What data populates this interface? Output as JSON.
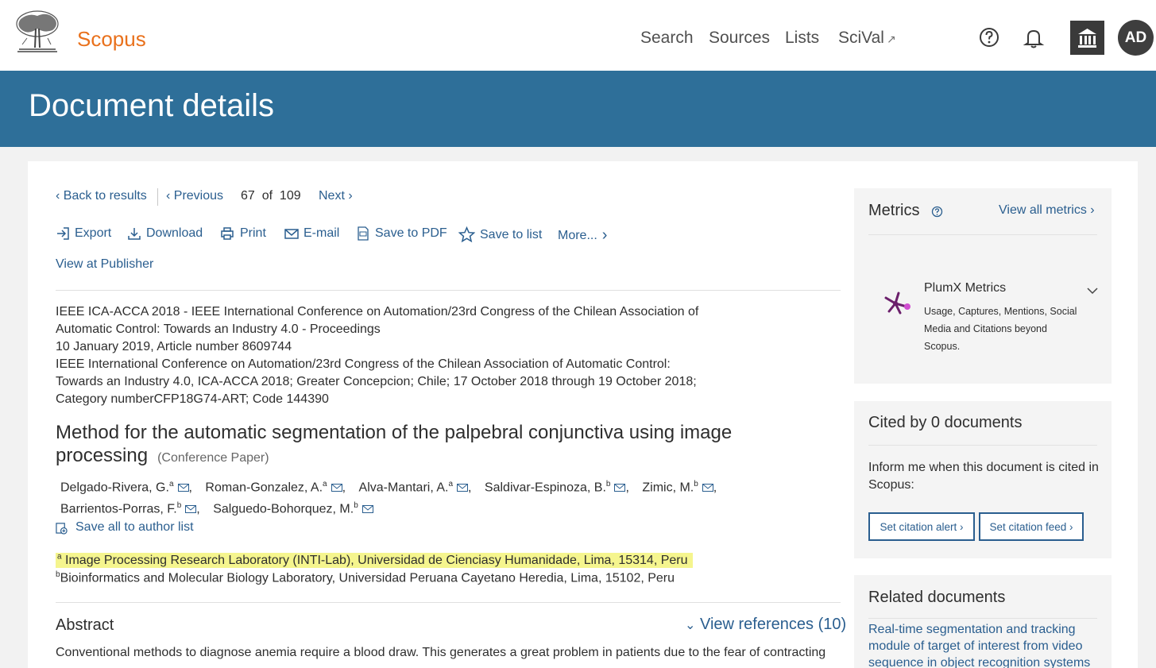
{
  "header": {
    "brand": "Scopus",
    "nav": {
      "search": "Search",
      "sources": "Sources",
      "lists": "Lists",
      "scival": "SciVal",
      "scival_ext": "↗"
    },
    "avatar_initials": "AD"
  },
  "banner": {
    "title": "Document details"
  },
  "pagination": {
    "back": "Back to results",
    "previous": "Previous",
    "current": "67",
    "of_label": "of",
    "total": "109",
    "next": "Next"
  },
  "toolbar": {
    "export": "Export",
    "download": "Download",
    "print": "Print",
    "email": "E-mail",
    "save_pdf": "Save to PDF",
    "save_list": "Save to list",
    "more": "More..."
  },
  "view_publisher": "View at Publisher",
  "source": {
    "lines": [
      "IEEE ICA-ACCA 2018 - IEEE International Conference on Automation/23rd Congress of the Chilean Association of",
      "Automatic Control: Towards an Industry 4.0 - Proceedings",
      "10 January 2019, Article number 8609744",
      "IEEE International Conference on Automation/23rd Congress of the Chilean Association of Automatic Control:",
      "Towards an Industry 4.0, ICA-ACCA 2018; Greater Concepcion; Chile; 17 October 2018 through 19 October 2018;",
      "Category numberCFP18G74-ART; Code 144390"
    ]
  },
  "document": {
    "title": "Method for the automatic segmentation of the palpebral conjunctiva using image processing",
    "type": "(Conference Paper)"
  },
  "authors": [
    {
      "name": "Delgado-Rivera, G.",
      "sup": "a"
    },
    {
      "name": "Roman-Gonzalez, A.",
      "sup": "a"
    },
    {
      "name": "Alva-Mantari, A.",
      "sup": "a"
    },
    {
      "name": "Saldivar-Espinoza, B.",
      "sup": "b"
    },
    {
      "name": "Zimic, M.",
      "sup": "b"
    },
    {
      "name": "Barrientos-Porras, F.",
      "sup": "b"
    },
    {
      "name": "Salguedo-Bohorquez, M.",
      "sup": "b"
    }
  ],
  "save_authors": "Save all to author list",
  "affiliations": [
    {
      "sup": "a",
      "text": "Image Processing Research Laboratory (INTI-Lab), Universidad de Cienciasy Humanidade, Lima, 15314, Peru"
    },
    {
      "sup": "b",
      "text": "Bioinformatics and Molecular Biology Laboratory, Universidad Peruana Cayetano Heredia, Lima, 15102, Peru"
    }
  ],
  "abstract": {
    "title": "Abstract",
    "view_refs": "View references (10)",
    "text": "Conventional methods to diagnose anemia require a blood draw. This generates a great problem in patients due to the fear of contracting"
  },
  "metrics": {
    "title": "Metrics",
    "view_all": "View all metrics",
    "plumx_title": "PlumX Metrics",
    "plumx_desc": "Usage, Captures, Mentions, Social Media and Citations beyond Scopus."
  },
  "cited": {
    "title": "Cited by 0 documents",
    "desc": "Inform me when this document is cited in Scopus:",
    "alert_btn": "Set citation alert",
    "feed_btn": "Set citation feed"
  },
  "related": {
    "title": "Related documents",
    "first_link": "Real-time segmentation and tracking module of target of interest from video sequence in object recognition systems"
  },
  "colors": {
    "brand": "#e9711c",
    "banner": "#2e6f99",
    "link": "#2a5e8f",
    "highlight": "#f5f58e"
  }
}
